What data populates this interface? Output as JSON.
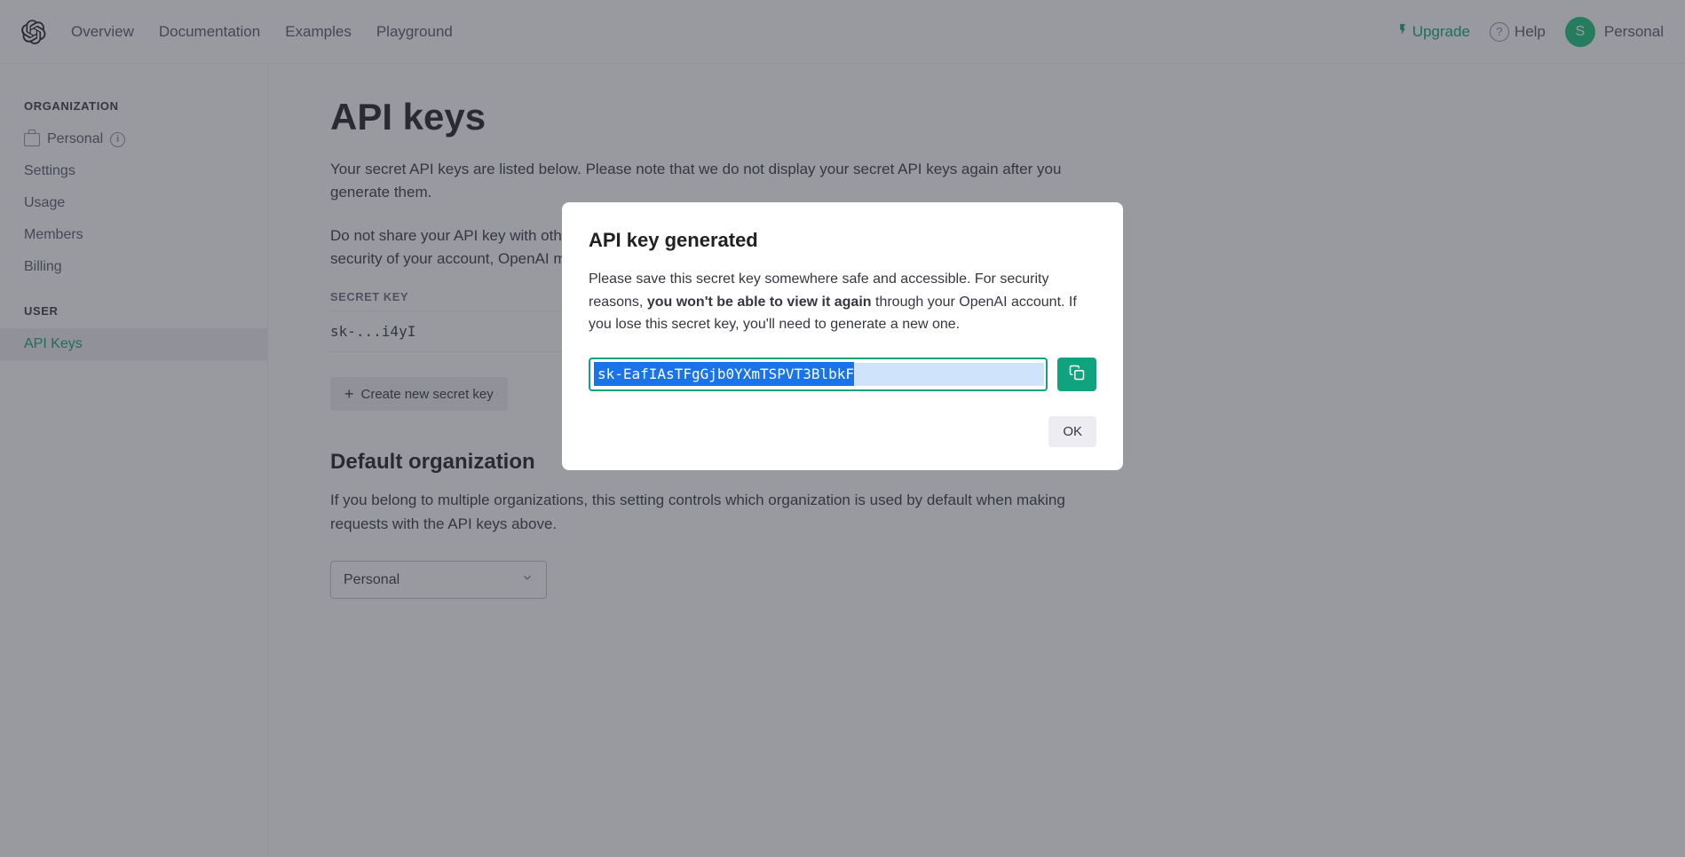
{
  "header": {
    "nav": [
      "Overview",
      "Documentation",
      "Examples",
      "Playground"
    ],
    "upgrade": "Upgrade",
    "help": "Help",
    "user_initial": "S",
    "user_name": "Personal"
  },
  "sidebar": {
    "org_label": "ORGANIZATION",
    "org_name": "Personal",
    "org_items": [
      "Settings",
      "Usage",
      "Members",
      "Billing"
    ],
    "user_label": "USER",
    "user_items": [
      "API Keys"
    ]
  },
  "page": {
    "title": "API keys",
    "desc1": "Your secret API keys are listed below. Please note that we do not display your secret API keys again after you generate them.",
    "desc2_a": "Do not share your API key with others, or expose it in the browser or other client-side code. In order to protect the security of your account, OpenAI may also automatically rotate any API key that we've found has leaked publicly.",
    "table_header_key": "SECRET KEY",
    "row_key": "sk-...i4yI",
    "create_btn": "Create new secret key",
    "default_org_title": "Default organization",
    "default_org_desc": "If you belong to multiple organizations, this setting controls which organization is used by default when making requests with the API keys above.",
    "select_value": "Personal"
  },
  "modal": {
    "title": "API key generated",
    "body_1": "Please save this secret key somewhere safe and accessible. For security reasons, ",
    "body_strong": "you won't be able to view it again",
    "body_2": " through your OpenAI account. If you lose this secret key, you'll need to generate a new one.",
    "key_value": "sk-EafIAsTFgGjb0YXmTSPVT3BlbkF",
    "ok": "OK"
  }
}
